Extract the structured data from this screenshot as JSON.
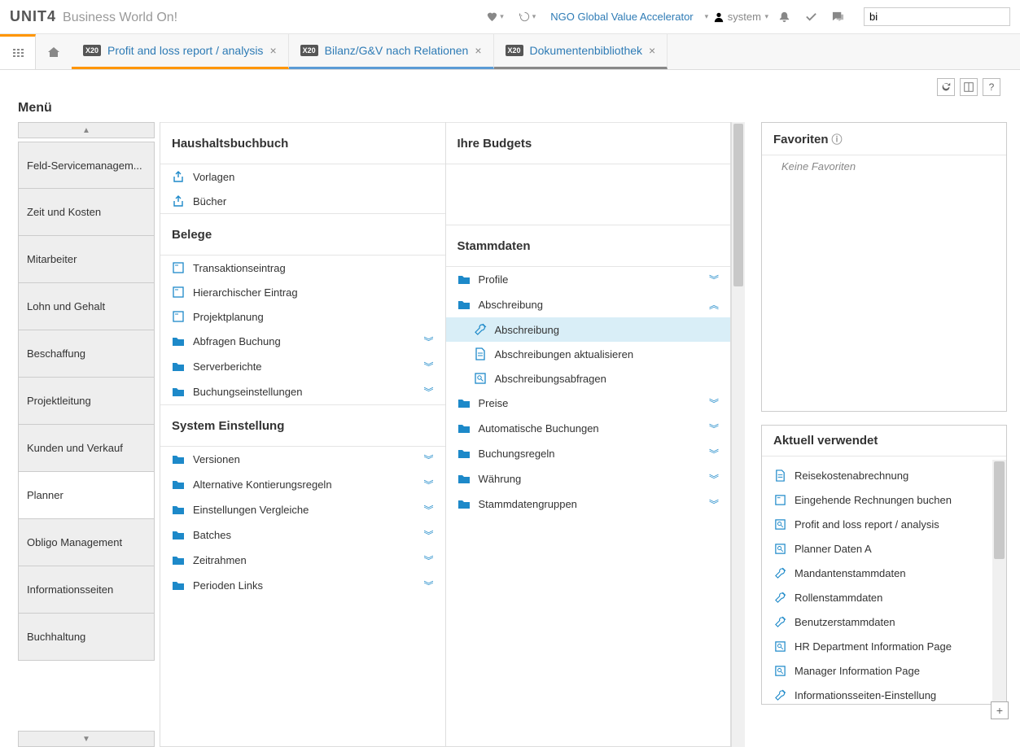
{
  "brand": {
    "name": "UNIT4",
    "suffix": "Business World On!"
  },
  "header": {
    "org": "NGO Global Value Accelerator",
    "user": "system",
    "search_value": "bi"
  },
  "tabs": [
    {
      "badge": "X20",
      "label": "Profit and loss report / analysis",
      "color": "orange"
    },
    {
      "badge": "X20",
      "label": "Bilanz/G&V nach Relationen",
      "color": "blue"
    },
    {
      "badge": "X20",
      "label": "Dokumentenbibliothek",
      "color": "gray"
    }
  ],
  "menu_title": "Menü",
  "sidebar": [
    "Feld-Servicemanagem...",
    "Zeit und Kosten",
    "Mitarbeiter",
    "Lohn und Gehalt",
    "Beschaffung",
    "Projektleitung",
    "Kunden und Verkauf",
    "Planner",
    "Obligo Management",
    "Informationsseiten",
    "Buchhaltung"
  ],
  "sidebar_active": 7,
  "col1": {
    "s1_title": "Haushaltsbuchbuch",
    "s1_items": [
      {
        "icon": "export",
        "label": "Vorlagen"
      },
      {
        "icon": "export",
        "label": "Bücher"
      }
    ],
    "s2_title": "Belege",
    "s2_items": [
      {
        "icon": "form",
        "label": "Transaktionseintrag"
      },
      {
        "icon": "form",
        "label": "Hierarchischer Eintrag"
      },
      {
        "icon": "form",
        "label": "Projektplanung"
      },
      {
        "icon": "folder",
        "label": "Abfragen Buchung",
        "expand": true
      },
      {
        "icon": "folder",
        "label": "Serverberichte",
        "expand": true
      },
      {
        "icon": "folder",
        "label": "Buchungseinstellungen",
        "expand": true
      }
    ],
    "s3_title": "System Einstellung",
    "s3_items": [
      {
        "icon": "folder",
        "label": "Versionen",
        "expand": true
      },
      {
        "icon": "folder",
        "label": "Alternative Kontierungsregeln",
        "expand": true
      },
      {
        "icon": "folder",
        "label": "Einstellungen Vergleiche",
        "expand": true
      },
      {
        "icon": "folder",
        "label": "Batches",
        "expand": true
      },
      {
        "icon": "folder",
        "label": "Zeitrahmen",
        "expand": true
      },
      {
        "icon": "folder",
        "label": "Perioden Links",
        "expand": true
      }
    ]
  },
  "col2": {
    "s1_title": "Ihre Budgets",
    "s2_title": "Stammdaten",
    "s2_items": [
      {
        "icon": "folder",
        "label": "Profile",
        "expand": true
      },
      {
        "icon": "folder",
        "label": "Abschreibung",
        "expanded": true
      },
      {
        "icon": "tools",
        "label": "Abschreibung",
        "sub": true,
        "highlighted": true
      },
      {
        "icon": "doc",
        "label": "Abschreibungen aktualisieren",
        "sub": true
      },
      {
        "icon": "search",
        "label": "Abschreibungsabfragen",
        "sub": true
      },
      {
        "icon": "folder",
        "label": "Preise",
        "expand": true
      },
      {
        "icon": "folder",
        "label": "Automatische Buchungen",
        "expand": true
      },
      {
        "icon": "folder",
        "label": "Buchungsregeln",
        "expand": true
      },
      {
        "icon": "folder",
        "label": "Währung",
        "expand": true
      },
      {
        "icon": "folder",
        "label": "Stammdatengruppen",
        "expand": true
      }
    ]
  },
  "favorites": {
    "title": "Favoriten",
    "empty": "Keine Favoriten"
  },
  "recent": {
    "title": "Aktuell verwendet",
    "items": [
      {
        "icon": "doc",
        "label": "Reisekostenabrechnung"
      },
      {
        "icon": "form",
        "label": "Eingehende Rechnungen buchen"
      },
      {
        "icon": "search",
        "label": "Profit and loss report / analysis"
      },
      {
        "icon": "search",
        "label": "Planner Daten A"
      },
      {
        "icon": "tools",
        "label": "Mandantenstammdaten"
      },
      {
        "icon": "tools",
        "label": "Rollenstammdaten"
      },
      {
        "icon": "tools",
        "label": "Benutzerstammdaten"
      },
      {
        "icon": "search",
        "label": "HR Department Information Page"
      },
      {
        "icon": "search",
        "label": "Manager Information Page"
      },
      {
        "icon": "tools",
        "label": "Informationsseiten-Einstellung"
      }
    ]
  }
}
